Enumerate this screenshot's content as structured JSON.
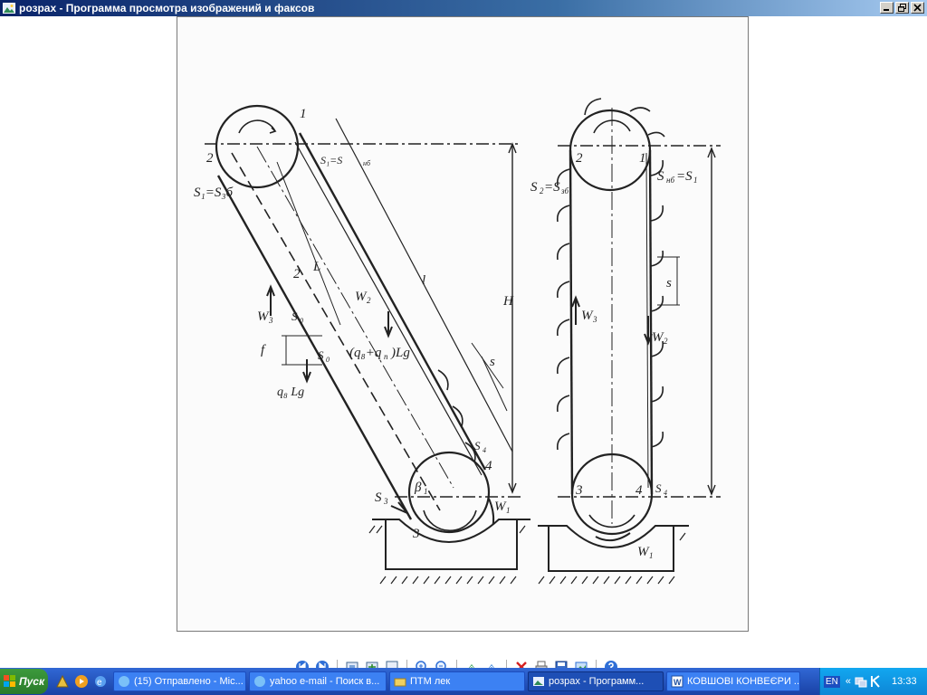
{
  "window": {
    "title": "розрах - Программа просмотра изображений и факсов"
  },
  "diagram": {
    "left": {
      "s1_s3b": "S₁=S₃б",
      "s1_snb": "S₁=S",
      "snb_sub": "нб",
      "w3": "W",
      "w3_sub": "3",
      "w2": "W",
      "w2_sub": "2",
      "w1": "W",
      "w1_sub": "1",
      "s0": "S",
      "s0_sub": "0",
      "s3": "S",
      "s3_sub": "3",
      "s4": "S",
      "s4_sub": "4",
      "f": "f",
      "s": "s",
      "h": "H",
      "l": "L",
      "l2": "l",
      "beta": "β",
      "beta_sub": "1",
      "qg": "(q₈+q",
      "qg2": "п",
      "qg3": ")Lg",
      "qb": "q₈ Lg",
      "n1": "1",
      "n2": "2",
      "n3": "3",
      "n4": "4",
      "n2b": "2"
    },
    "right": {
      "s2": "S",
      "s2_sub": "2",
      "s2_eq": "=S",
      "s2_eq_sub": "зб",
      "snb": "S",
      "snb_sub": "нб",
      "snb_eq": "=S",
      "snb_eq_sub": "1",
      "w3": "W",
      "w3_sub": "3",
      "w2": "W",
      "w2_sub": "2",
      "w1": "W",
      "w1_sub": "1",
      "s4": "S",
      "s4_sub": "4",
      "s": "s",
      "n1": "1",
      "n2": "2",
      "n3": "3",
      "n4": "4"
    }
  },
  "taskbar": {
    "start_label": "Пуск",
    "tasks": [
      {
        "label": "(15) Отправлено - Mic..."
      },
      {
        "label": "yahoo e-mail - Поиск в..."
      },
      {
        "label": "ПТМ лек"
      },
      {
        "label": "розрах - Программ..."
      },
      {
        "label": "КОВШОВІ КОНВЕЄРИ ..."
      }
    ],
    "lang": "EN",
    "clock": "13:33"
  }
}
